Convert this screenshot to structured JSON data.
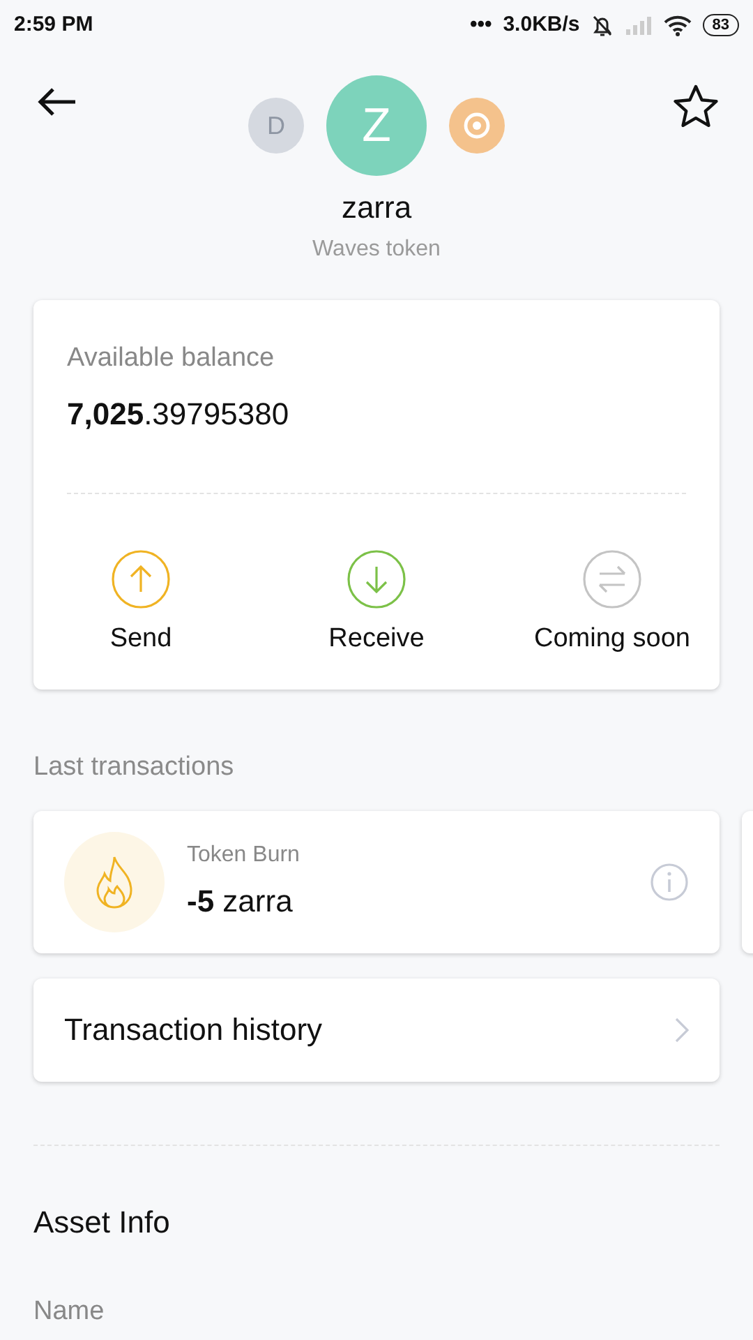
{
  "status_bar": {
    "time": "2:59 PM",
    "dots": "•••",
    "speed": "3.0KB/s",
    "battery": "83"
  },
  "asset": {
    "side_left_letter": "D",
    "letter": "Z",
    "name": "zarra",
    "subtitle": "Waves token"
  },
  "balance": {
    "label": "Available balance",
    "amount": "**7,025**.39795380"
  },
  "actions": [
    {
      "kind": "send",
      "label": "Send",
      "color": "#f0b323"
    },
    {
      "kind": "receive",
      "label": "Receive",
      "color": "#7cc148"
    },
    {
      "kind": "exchange",
      "label": "Coming soon",
      "color": "#c4c4c4"
    }
  ],
  "last_transactions": {
    "title": "Last transactions",
    "items": [
      {
        "kind": "burn",
        "type": "Token Burn",
        "amount": "**-5** zarra"
      }
    ]
  },
  "history_link": "Transaction history",
  "asset_info": {
    "title": "Asset Info",
    "fields": [
      {
        "label": "Name"
      }
    ]
  }
}
